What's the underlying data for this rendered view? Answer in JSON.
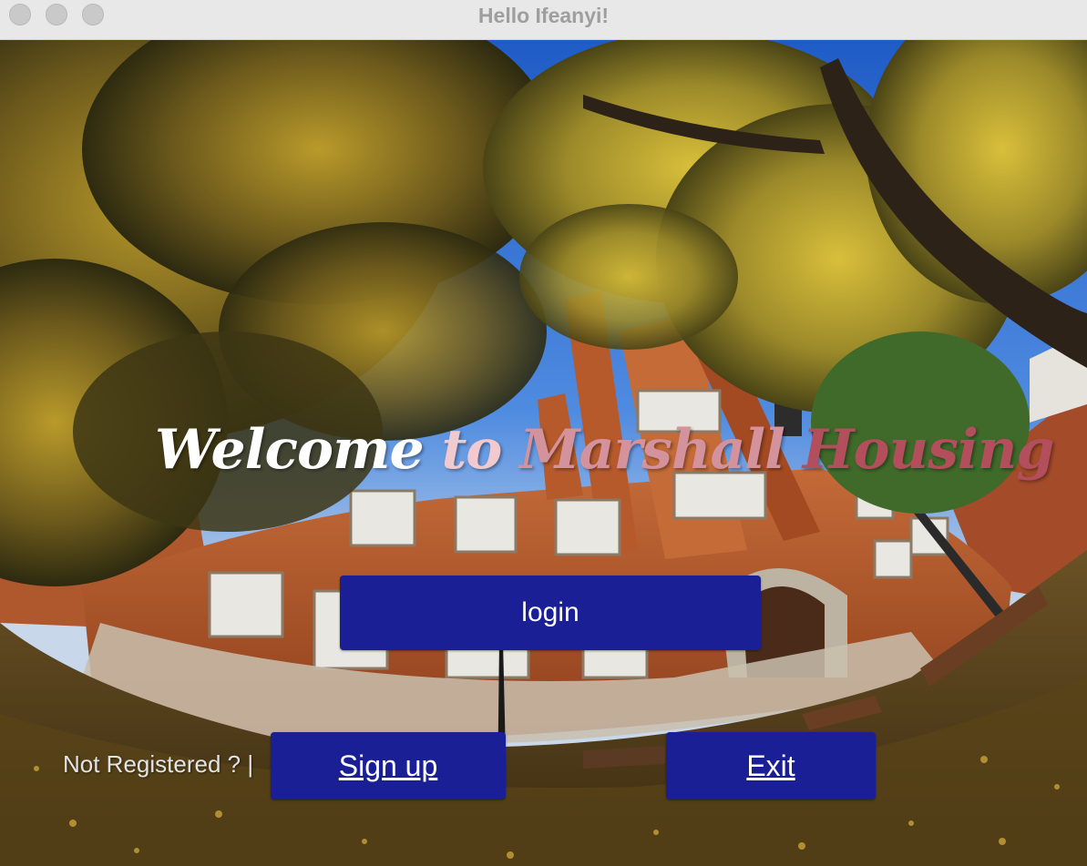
{
  "window": {
    "title": "Hello Ifeanyi!",
    "controls": [
      "close",
      "minimize",
      "maximize"
    ]
  },
  "background": {
    "icon": "campus-building-photo",
    "description_visible": false
  },
  "welcome": {
    "part1": "Welcome",
    "part2": "to",
    "part3": "Marshall",
    "part4": "Housing"
  },
  "buttons": {
    "login": "login",
    "signup": "Sign up",
    "exit": "Exit"
  },
  "prompt": {
    "not_registered": "Not Registered ? |"
  },
  "colors": {
    "button_bg": "#1a1f96",
    "button_text": "#ffffff",
    "welcome_white": "#ffffff",
    "welcome_pink": "#f2c9cf",
    "welcome_rose": "#d3929c",
    "welcome_red": "#b34e5c"
  }
}
